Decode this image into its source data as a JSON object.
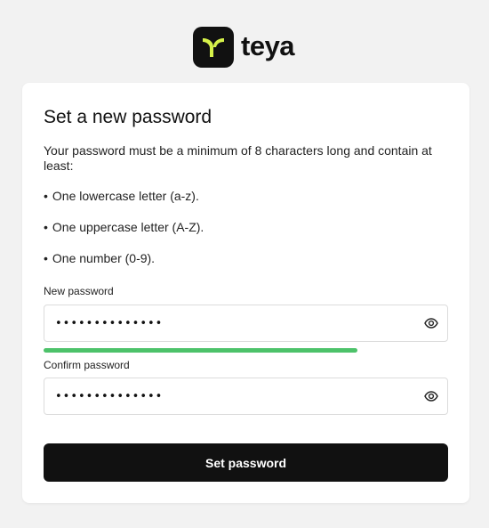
{
  "brand": {
    "name": "teya",
    "logo_icon": "teya-logo-icon",
    "logo_color": "#111111",
    "logo_accent": "#d6f24a"
  },
  "form": {
    "title": "Set a new password",
    "description": "Your password must be a minimum of 8 characters long and contain at least:",
    "bullet": "•",
    "rules": [
      "One lowercase letter (a-z).",
      "One uppercase letter (A-Z).",
      "One number (0-9)."
    ],
    "new_password": {
      "label": "New password",
      "value": "••••••••••••••",
      "toggle_icon": "eye-icon",
      "strength": 0.78,
      "strength_color": "#4dc26a"
    },
    "confirm_password": {
      "label": "Confirm password",
      "value": "••••••••••••••",
      "toggle_icon": "eye-icon"
    },
    "submit_label": "Set password"
  }
}
